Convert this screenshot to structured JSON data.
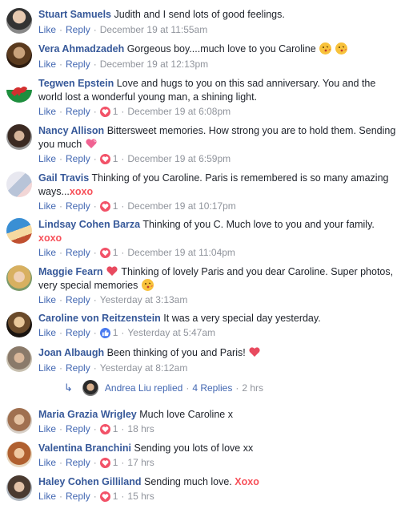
{
  "actions": {
    "like": "Like",
    "reply": "Reply",
    "separator": "·"
  },
  "comments": [
    {
      "author": "Stuart Samuels",
      "text": "Judith and I send lots of good feelings.",
      "reactions": "",
      "time": "December 19 at 11:55am"
    },
    {
      "author": "Vera Ahmadzadeh",
      "text": "Gorgeous boy....much love to you Caroline",
      "reactions": "",
      "time": "December 19 at 12:13pm"
    },
    {
      "author": "Tegwen Epstein",
      "text": "Love and hugs to you on this sad anniversary. You and the world lost a wonderful young man, a shining light.",
      "reactions": "1",
      "time": "December 19 at 6:08pm"
    },
    {
      "author": "Nancy Allison",
      "text": "Bittersweet memories. How strong you are to hold them. Sending you much",
      "reactions": "1",
      "time": "December 19 at 6:59pm"
    },
    {
      "author": "Gail Travis",
      "text": "Thinking of you Caroline. Paris is remembered is so many amazing ways...",
      "accent": "xoxo",
      "reactions": "1",
      "time": "December 19 at 10:17pm"
    },
    {
      "author": "Lindsay Cohen Barza",
      "text": "Thinking of you C. Much love to you and your family.",
      "accent": "xoxo",
      "reactions": "1",
      "time": "December 19 at 11:04pm"
    },
    {
      "author": "Maggie Fearn",
      "text": "Thinking of lovely Paris and you dear Caroline. Super photos, very special memories",
      "reactions": "",
      "time": "Yesterday at 3:13am"
    },
    {
      "author": "Caroline von Reitzenstein",
      "text": "It was a very special day yesterday.",
      "reactions": "1",
      "time": "Yesterday at 5:47am"
    },
    {
      "author": "Joan Albaugh",
      "text": "Been thinking of you and Paris!",
      "reactions": "",
      "time": "Yesterday at 8:12am"
    },
    {
      "author": "Maria Grazia Wrigley",
      "text": "Much love Caroline x",
      "reactions": "1",
      "time": "18 hrs"
    },
    {
      "author": "Valentina Branchini",
      "text": "Sending you lots of love xx",
      "reactions": "1",
      "time": "17 hrs"
    },
    {
      "author": "Haley Cohen Gilliland",
      "text": "Sending much love.",
      "accent": "Xoxo",
      "reactions": "1",
      "time": "15 hrs"
    }
  ],
  "replies": {
    "author": "Andrea Liu",
    "verb": "replied",
    "count_label": "4 Replies",
    "time": "2 hrs"
  },
  "colors": {
    "link": "#365899",
    "action": "#4267b2",
    "muted": "#90949c",
    "love": "#f25268",
    "like": "#4a7bf0",
    "accent": "#f7515a"
  }
}
